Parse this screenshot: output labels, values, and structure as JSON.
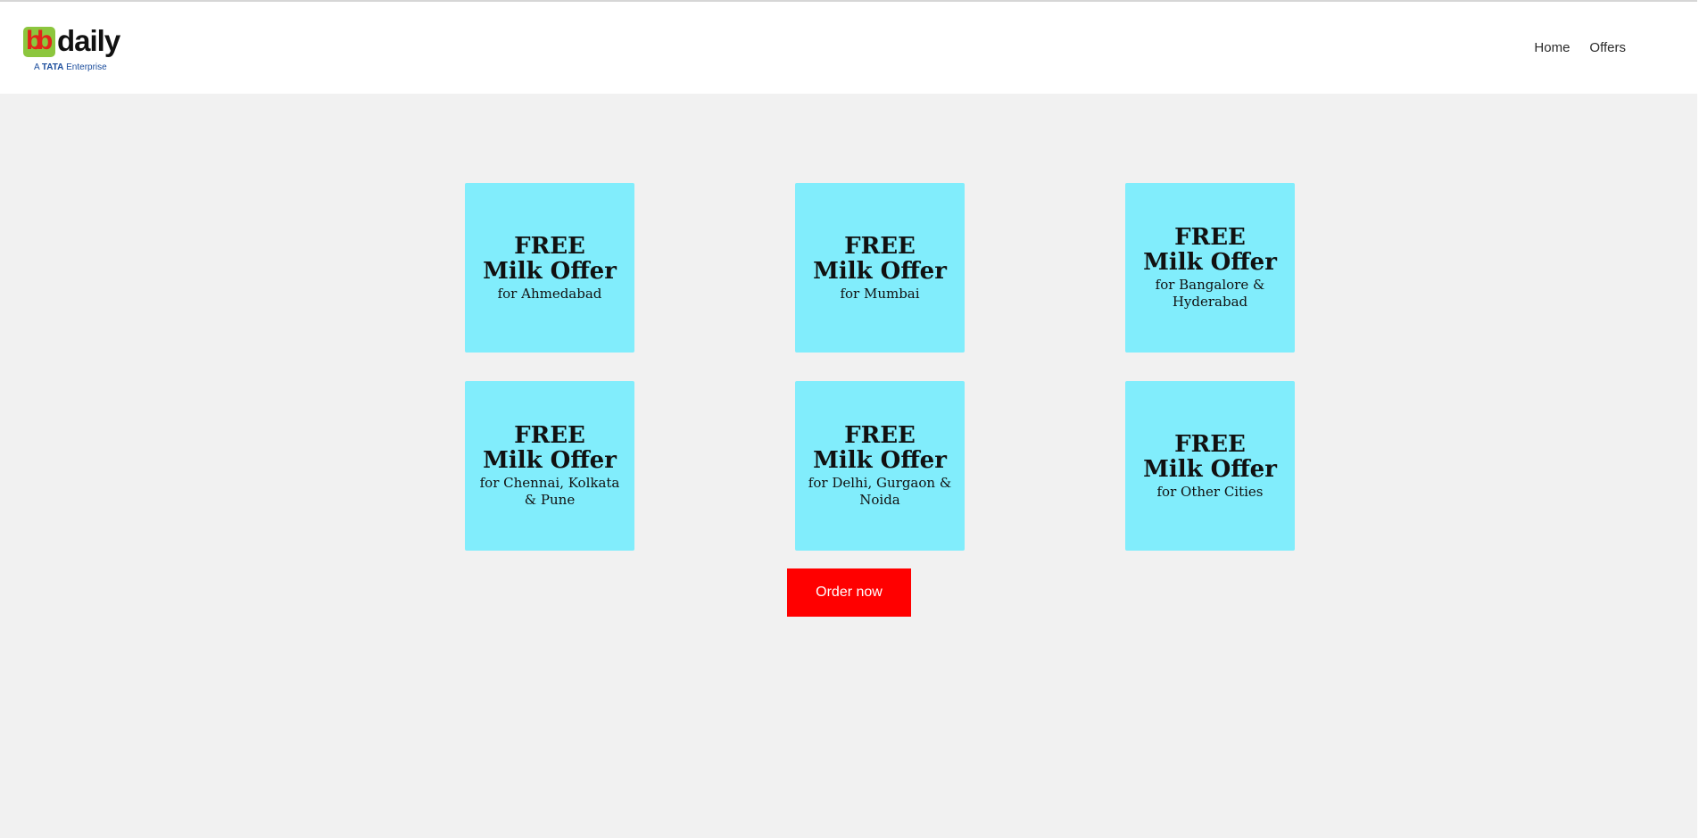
{
  "header": {
    "logo": {
      "badge_text": "bb",
      "word": "daily",
      "tagline_prefix": "A",
      "tagline_brand": "TATA",
      "tagline_suffix": "Enterprise"
    },
    "nav": [
      {
        "label": "Home"
      },
      {
        "label": "Offers"
      }
    ]
  },
  "offers": [
    {
      "title": "FREE",
      "subtitle": "Milk Offer",
      "city": "for Ahmedabad"
    },
    {
      "title": "FREE",
      "subtitle": "Milk Offer",
      "city": "for Mumbai"
    },
    {
      "title": "FREE",
      "subtitle": "Milk Offer",
      "city": "for Bangalore & Hyderabad"
    },
    {
      "title": "FREE",
      "subtitle": "Milk Offer",
      "city": "for Chennai, Kolkata & Pune"
    },
    {
      "title": "FREE",
      "subtitle": "Milk Offer",
      "city": "for Delhi, Gurgaon & Noida"
    },
    {
      "title": "FREE",
      "subtitle": "Milk Offer",
      "city": "for Other Cities"
    }
  ],
  "cta": {
    "label": "Order now"
  },
  "colors": {
    "card_bg": "#81edfc",
    "cta_bg": "#ff0000",
    "page_bg": "#f1f1f1",
    "logo_green": "#8cc63e",
    "logo_red": "#e2231a",
    "tata_blue": "#1a4c9c"
  }
}
